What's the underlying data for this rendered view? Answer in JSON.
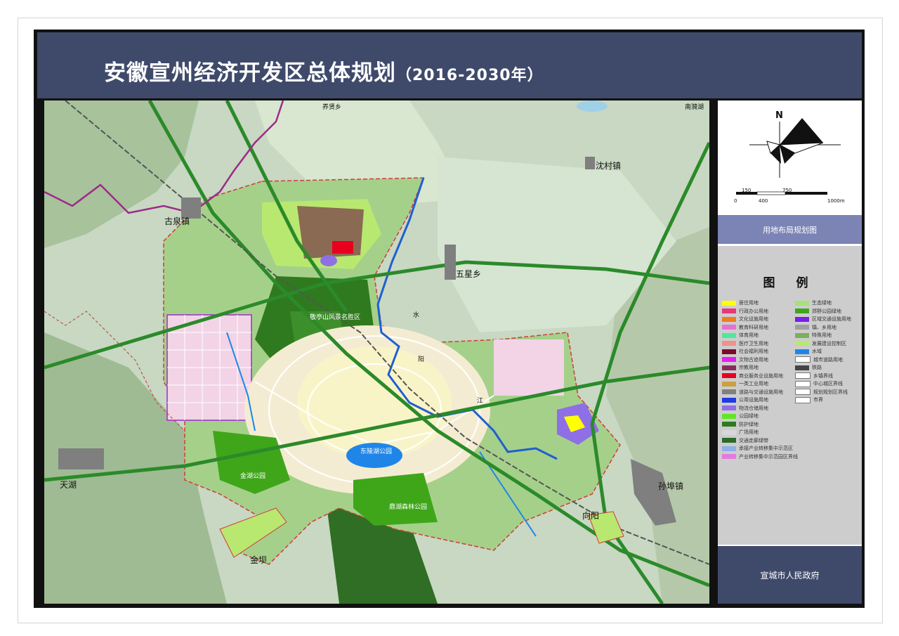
{
  "title": {
    "main": "安徽宣州经济开发区总体规划",
    "years": "（2016-2030年）"
  },
  "map": {
    "places": {
      "yangxian": "养贤乡",
      "nanyi": "南漪湖",
      "shencun": "沈村镇",
      "gugao": "古泉镇",
      "wuxing": "五星乡",
      "jingting": "敬亭山风景名胜区",
      "shui1": "水",
      "shui2": "阳",
      "shui3": "江",
      "dongling": "东陵湖公园",
      "jinhu": "金湖公园",
      "dingxing": "鼎湖森林公园",
      "tianhu": "天湖",
      "sunbu": "孙埠镇",
      "xiangyang": "向阳",
      "jinba": "金坝"
    }
  },
  "panel": {
    "north": "N",
    "scale_top": [
      "150",
      "750"
    ],
    "scale_bottom": [
      "0",
      "400",
      "1000m"
    ],
    "subtitle": "用地布局规划图",
    "legend_title": "图 例",
    "legend_left": [
      {
        "label": "居住用地",
        "color": "#ffff00"
      },
      {
        "label": "行政办公用地",
        "color": "#e8377b"
      },
      {
        "label": "文化设施用地",
        "color": "#f07d1e"
      },
      {
        "label": "教育科研用地",
        "color": "#e86fd3"
      },
      {
        "label": "体育用地",
        "color": "#4fe89a"
      },
      {
        "label": "医疗卫生用地",
        "color": "#f0918a"
      },
      {
        "label": "社会福利用地",
        "color": "#7c0a2a"
      },
      {
        "label": "文物古迹用地",
        "color": "#e21ff0"
      },
      {
        "label": "宗教用地",
        "color": "#8a2a5a"
      },
      {
        "label": "商业服务业设施用地",
        "color": "#e8001e"
      },
      {
        "label": "一类工业用地",
        "color": "#c9a23f"
      },
      {
        "label": "道路与交通设施用地",
        "color": "#808080"
      },
      {
        "label": "公用设施用地",
        "color": "#1f3ae8"
      },
      {
        "label": "物流仓储用地",
        "color": "#8f6fe6"
      },
      {
        "label": "公园绿地",
        "color": "#5fe81f"
      },
      {
        "label": "防护绿地",
        "color": "#2f7a1e"
      },
      {
        "label": "广场用地",
        "color": "#d8d8d8"
      },
      {
        "label": "交通走廊绿带",
        "color": "#2b6b2a"
      },
      {
        "label": "承接产业转移集中示范区",
        "color": "#8fb0e8"
      },
      {
        "label": "产业转移集中示范园区界线",
        "color": "#e47ae0"
      }
    ],
    "legend_right": [
      {
        "label": "生态绿地",
        "color": "#a8e07a"
      },
      {
        "label": "郊野公园绿地",
        "color": "#3fa61a"
      },
      {
        "label": "区域交通设施用地",
        "color": "#7a1fe8"
      },
      {
        "label": "镇、乡用地",
        "color": "#a0a0a0"
      },
      {
        "label": "特殊用地",
        "color": "#7ab05a"
      },
      {
        "label": "发展建设控制区",
        "color": "#b8e870"
      },
      {
        "label": "水域",
        "color": "#1f86e8"
      },
      {
        "label": "城市道路用地",
        "color": "#ffffff"
      },
      {
        "label": "铁路",
        "color": "#444444"
      },
      {
        "label": "乡镇界线",
        "color": "#ffffff"
      },
      {
        "label": "中心城区界线",
        "color": "#ffffff"
      },
      {
        "label": "规划规划区界线",
        "color": "#ffffff"
      },
      {
        "label": "市界",
        "color": "#ffffff"
      }
    ],
    "government": "宣城市人民政府"
  }
}
